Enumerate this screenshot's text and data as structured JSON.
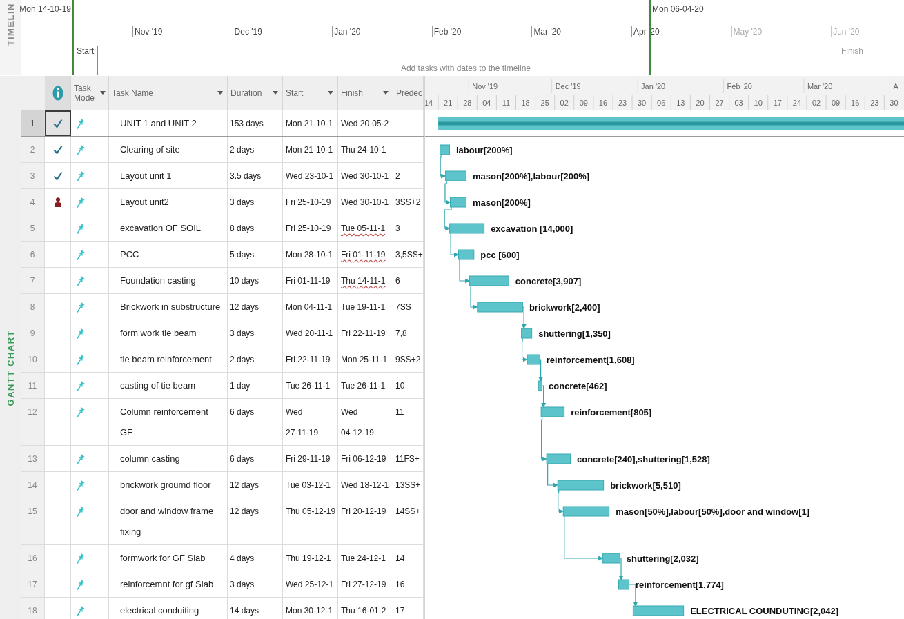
{
  "timeline": {
    "label": "TIMELIN",
    "start_date": "Mon 14-10-19",
    "current_date": "Mon 06-04-20",
    "months": [
      {
        "label": "Nov '19",
        "dimmed": false
      },
      {
        "label": "Dec '19",
        "dimmed": false
      },
      {
        "label": "Jan '20",
        "dimmed": false
      },
      {
        "label": "Feb '20",
        "dimmed": false
      },
      {
        "label": "Mar '20",
        "dimmed": false
      },
      {
        "label": "Apr '20",
        "dimmed": false
      },
      {
        "label": "May '20",
        "dimmed": true
      },
      {
        "label": "Jun '20",
        "dimmed": true
      }
    ],
    "start_label": "Start",
    "finish_label": "Finish",
    "placeholder": "Add tasks with dates to the timeline"
  },
  "view_label": "GANTT CHART",
  "table": {
    "columns": [
      {
        "kind": "info"
      },
      {
        "kind": "mode",
        "label": "Task Mode"
      },
      {
        "kind": "name",
        "label": "Task Name"
      },
      {
        "kind": "duration",
        "label": "Duration"
      },
      {
        "kind": "start",
        "label": "Start"
      },
      {
        "kind": "finish",
        "label": "Finish"
      },
      {
        "kind": "predecessors",
        "label": "Predec"
      }
    ],
    "tasks": [
      {
        "id": "1",
        "selected": true,
        "summary": true,
        "completed": true,
        "resource_indicator": false,
        "manually_scheduled": true,
        "name": "UNIT 1 and UNIT 2",
        "duration": "153 days",
        "start": "Mon 21-10-1",
        "finish": "Wed 20-05-2",
        "finish_flagged": false
      },
      {
        "id": "2",
        "selected": false,
        "summary": false,
        "completed": true,
        "resource_indicator": false,
        "manually_scheduled": true,
        "name": "Clearing of site",
        "duration": "2 days",
        "start": "Mon 21-10-1",
        "finish": "Thu 24-10-1",
        "finish_flagged": false,
        "bar_label": "labour[200%]"
      },
      {
        "id": "3",
        "selected": false,
        "summary": false,
        "completed": true,
        "resource_indicator": false,
        "manually_scheduled": true,
        "name": "Layout unit 1",
        "duration": "3.5 days",
        "start": "Wed 23-10-1",
        "finish": "Wed 30-10-1",
        "finish_flagged": false,
        "predecessors": "2",
        "bar_label": "mason[200%],labour[200%]"
      },
      {
        "id": "4",
        "selected": false,
        "summary": false,
        "completed": false,
        "resource_indicator": true,
        "manually_scheduled": true,
        "name": "Layout unit2",
        "duration": "3 days",
        "start": "Fri 25-10-19",
        "finish": "Wed 30-10-1",
        "finish_flagged": false,
        "predecessors": "3SS+2",
        "bar_label": "mason[200%]"
      },
      {
        "id": "5",
        "selected": false,
        "summary": false,
        "completed": false,
        "resource_indicator": false,
        "manually_scheduled": true,
        "name": "excavation OF SOIL",
        "duration": "8 days",
        "start": "Fri 25-10-19",
        "finish": "Tue 05-11-1",
        "finish_flagged": true,
        "predecessors": "3",
        "bar_label": "excavation [14,000]"
      },
      {
        "id": "6",
        "selected": false,
        "summary": false,
        "completed": false,
        "resource_indicator": false,
        "manually_scheduled": true,
        "name": "PCC",
        "duration": "5 days",
        "start": "Mon 28-10-1",
        "finish": "Fri 01-11-19",
        "finish_flagged": true,
        "predecessors": "3,5SS+",
        "bar_label": "pcc [600]"
      },
      {
        "id": "7",
        "selected": false,
        "summary": false,
        "completed": false,
        "resource_indicator": false,
        "manually_scheduled": true,
        "name": "Foundation casting",
        "duration": "10 days",
        "start": "Fri 01-11-19",
        "finish": "Thu 14-11-1",
        "finish_flagged": true,
        "predecessors": "6",
        "bar_label": "concrete[3,907]"
      },
      {
        "id": "8",
        "selected": false,
        "summary": false,
        "completed": false,
        "resource_indicator": false,
        "manually_scheduled": true,
        "name": "Brickwork in substructure",
        "duration": "12 days",
        "start": "Mon 04-11-1",
        "finish": "Tue 19-11-1",
        "finish_flagged": false,
        "predecessors": "7SS",
        "bar_label": "brickwork[2,400]"
      },
      {
        "id": "9",
        "selected": false,
        "summary": false,
        "completed": false,
        "resource_indicator": false,
        "manually_scheduled": true,
        "name": "form work tie beam",
        "duration": "3 days",
        "start": "Wed 20-11-1",
        "finish": "Fri 22-11-19",
        "finish_flagged": false,
        "predecessors": "7,8",
        "bar_label": "shuttering[1,350]"
      },
      {
        "id": "10",
        "selected": false,
        "summary": false,
        "completed": false,
        "resource_indicator": false,
        "manually_scheduled": true,
        "name": "tie beam reinforcement",
        "duration": "2 days",
        "start": "Fri 22-11-19",
        "finish": "Mon 25-11-1",
        "finish_flagged": false,
        "predecessors": "9SS+2",
        "bar_label": "reinforcement[1,608]"
      },
      {
        "id": "11",
        "selected": false,
        "summary": false,
        "completed": false,
        "resource_indicator": false,
        "manually_scheduled": true,
        "name": "casting of tie beam",
        "duration": "1 day",
        "start": "Tue 26-11-1",
        "finish": "Tue 26-11-1",
        "finish_flagged": false,
        "predecessors": "10",
        "bar_label": "concrete[462]"
      },
      {
        "id": "12",
        "selected": false,
        "summary": false,
        "completed": false,
        "resource_indicator": false,
        "manually_scheduled": true,
        "name": "Column reinforcement GF",
        "duration": "6 days",
        "start": "Wed 27-11-19",
        "finish": "Wed 04-12-19",
        "finish_flagged": false,
        "predecessors": "11",
        "bar_label": "reinforcement[805]"
      },
      {
        "id": "13",
        "selected": false,
        "summary": false,
        "completed": false,
        "resource_indicator": false,
        "manually_scheduled": true,
        "name": "column casting",
        "duration": "6 days",
        "start": "Fri 29-11-19",
        "finish": "Fri 06-12-19",
        "finish_flagged": false,
        "predecessors": "11FS+",
        "bar_label": "concrete[240],shuttering[1,528]"
      },
      {
        "id": "14",
        "selected": false,
        "summary": false,
        "completed": false,
        "resource_indicator": false,
        "manually_scheduled": true,
        "name": "brickwork groumd floor",
        "duration": "12 days",
        "start": "Tue 03-12-1",
        "finish": "Wed 18-12-1",
        "finish_flagged": false,
        "predecessors": "13SS+",
        "bar_label": "brickwork[5,510]"
      },
      {
        "id": "15",
        "selected": false,
        "summary": false,
        "completed": false,
        "resource_indicator": false,
        "manually_scheduled": true,
        "name": "door and window frame fixing",
        "duration": "12 days",
        "start": "Thu 05-12-19",
        "finish": "Fri 20-12-19",
        "finish_flagged": false,
        "predecessors": "14SS+",
        "bar_label": "mason[50%],labour[50%],door and window[1]"
      },
      {
        "id": "16",
        "selected": false,
        "summary": false,
        "completed": false,
        "resource_indicator": false,
        "manually_scheduled": true,
        "name": "formwork for GF Slab",
        "duration": "4 days",
        "start": "Thu 19-12-1",
        "finish": "Tue 24-12-1",
        "finish_flagged": false,
        "predecessors": "14",
        "bar_label": "shuttering[2,032]"
      },
      {
        "id": "17",
        "selected": false,
        "summary": false,
        "completed": false,
        "resource_indicator": false,
        "manually_scheduled": true,
        "name": "reinforcemnt for gf Slab",
        "duration": "3 days",
        "start": "Wed 25-12-1",
        "finish": "Fri 27-12-19",
        "finish_flagged": false,
        "predecessors": "16",
        "bar_label": "reinforcement[1,774]"
      },
      {
        "id": "18",
        "selected": false,
        "summary": false,
        "completed": false,
        "resource_indicator": false,
        "manually_scheduled": true,
        "name": "electrical conduiting",
        "duration": "14 days",
        "start": "Mon 30-12-1",
        "finish": "Thu 16-01-2",
        "finish_flagged": false,
        "predecessors": "17",
        "bar_label": "ELECTRICAL COUNDUTING[2,042]"
      }
    ]
  },
  "gantt": {
    "timescale": {
      "months": [
        "Nov '19",
        "Dec '19",
        "Jan '20",
        "Feb '20",
        "Mar '20",
        "A"
      ],
      "weeks": [
        "14",
        "21",
        "28",
        "04",
        "11",
        "18",
        "25",
        "02",
        "09",
        "16",
        "23",
        "30",
        "06",
        "13",
        "20",
        "27",
        "03",
        "10",
        "17",
        "24",
        "02",
        "09",
        "16",
        "23",
        "30"
      ]
    }
  }
}
